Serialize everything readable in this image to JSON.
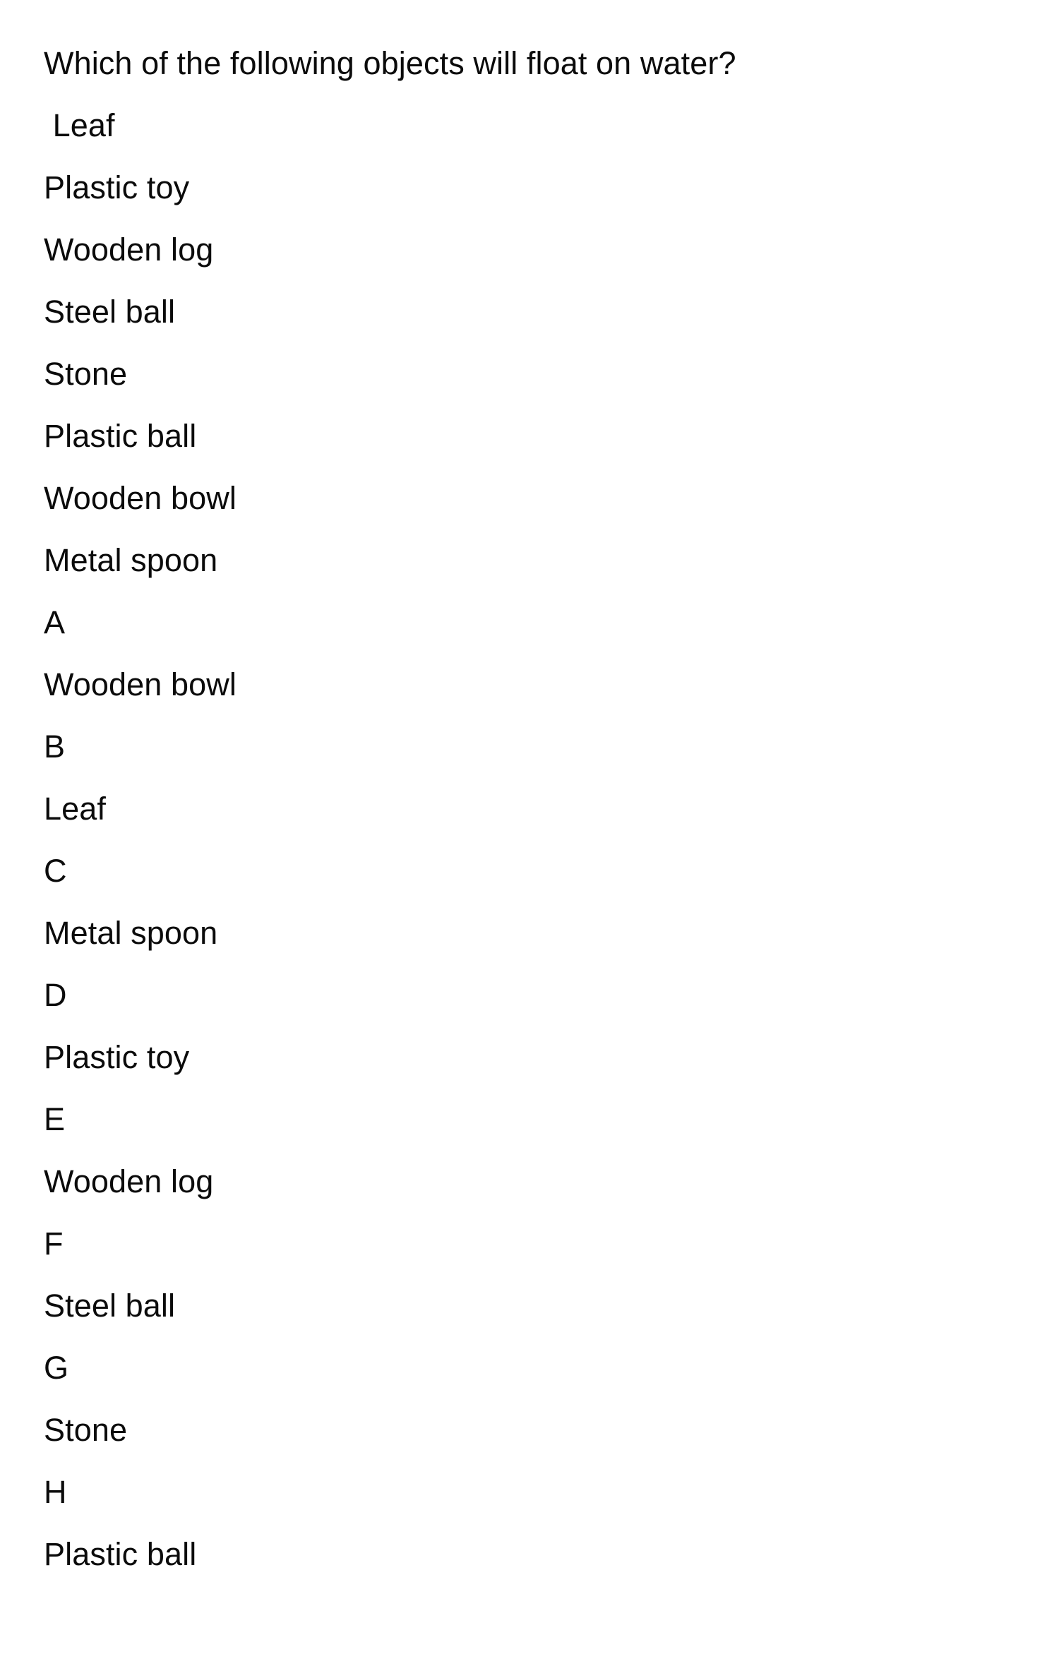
{
  "document": {
    "question": "Which of the following objects will float on water?",
    "object_list": [
      " Leaf",
      "Plastic toy",
      "Wooden log",
      "Steel ball",
      "Stone",
      "Plastic ball",
      "Wooden bowl",
      "Metal spoon"
    ],
    "choices": [
      {
        "letter": "A",
        "text": "Wooden bowl"
      },
      {
        "letter": "B",
        "text": "Leaf"
      },
      {
        "letter": "C",
        "text": "Metal spoon"
      },
      {
        "letter": "D",
        "text": "Plastic toy"
      },
      {
        "letter": "E",
        "text": "Wooden log"
      },
      {
        "letter": "F",
        "text": "Steel ball"
      },
      {
        "letter": "G",
        "text": "Stone"
      },
      {
        "letter": "H",
        "text": "Plastic ball"
      }
    ],
    "lines": [
      "Which of the following objects will float on water?",
      " Leaf",
      "Plastic toy",
      "Wooden log",
      "Steel ball",
      "Stone",
      "Plastic ball",
      "Wooden bowl",
      "Metal spoon",
      "A",
      "Wooden bowl",
      "B",
      "Leaf",
      "C",
      "Metal spoon",
      "D",
      "Plastic toy",
      "E",
      "Wooden log",
      "F",
      "Steel ball",
      "G",
      "Stone",
      "H",
      "Plastic ball"
    ]
  },
  "style": {
    "text_color": "#0b0b0b",
    "background_color": "#ffffff"
  }
}
